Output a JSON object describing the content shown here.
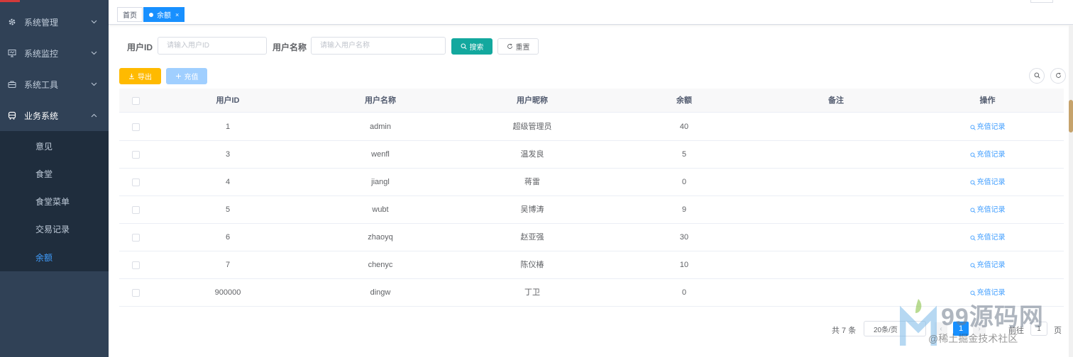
{
  "sidebar": {
    "menus": [
      {
        "label": "系统管理",
        "icon": "gear-icon"
      },
      {
        "label": "系统监控",
        "icon": "monitor-icon"
      },
      {
        "label": "系统工具",
        "icon": "toolbox-icon"
      },
      {
        "label": "业务系统",
        "icon": "bus-icon"
      }
    ],
    "submenu": [
      {
        "label": "意见"
      },
      {
        "label": "食堂"
      },
      {
        "label": "食堂菜单"
      },
      {
        "label": "交易记录"
      },
      {
        "label": "余额"
      }
    ],
    "active_submenu": "余额"
  },
  "tags": [
    {
      "label": "首页"
    },
    {
      "label": "余额",
      "close": "×"
    }
  ],
  "search": {
    "user_id_label": "用户ID",
    "user_id_placeholder": "请输入用户ID",
    "user_id_value": "",
    "user_name_label": "用户名称",
    "user_name_placeholder": "请输入用户名称",
    "user_name_value": "",
    "search_button": "搜索",
    "reset_button": "重置"
  },
  "toolbar": {
    "export_button": "导出",
    "recharge_button": "充值"
  },
  "table": {
    "columns": [
      "用户ID",
      "用户名称",
      "用户昵称",
      "余额",
      "备注",
      "操作"
    ],
    "rows": [
      {
        "id": "1",
        "name": "admin",
        "nickname": "超级管理员",
        "balance": "40",
        "remark": "",
        "action": "充值记录"
      },
      {
        "id": "3",
        "name": "wenfl",
        "nickname": "温发良",
        "balance": "5",
        "remark": "",
        "action": "充值记录"
      },
      {
        "id": "4",
        "name": "jiangl",
        "nickname": "蒋雷",
        "balance": "0",
        "remark": "",
        "action": "充值记录"
      },
      {
        "id": "5",
        "name": "wubt",
        "nickname": "吴博涛",
        "balance": "9",
        "remark": "",
        "action": "充值记录"
      },
      {
        "id": "6",
        "name": "zhaoyq",
        "nickname": "赵亚强",
        "balance": "30",
        "remark": "",
        "action": "充值记录"
      },
      {
        "id": "7",
        "name": "chenyc",
        "nickname": "陈仪椿",
        "balance": "10",
        "remark": "",
        "action": "充值记录"
      },
      {
        "id": "900000",
        "name": "dingw",
        "nickname": "丁卫",
        "balance": "0",
        "remark": "",
        "action": "充值记录"
      }
    ]
  },
  "pagination": {
    "total": "共 7 条",
    "page_size": "20条/页",
    "current_page": "1",
    "goto_label": "前往",
    "goto_value": "1",
    "page_suffix": "页"
  },
  "watermark": {
    "brand": "99源码网",
    "community": "@稀土掘金技术社区"
  },
  "colors": {
    "sidebar_bg": "#304156",
    "submenu_bg": "#1f2d3d",
    "active": "#409eff",
    "search_button": "#13a89e",
    "export_button": "#ffba00",
    "recharge_button": "#a0cfff",
    "current_page": "#1890ff"
  }
}
